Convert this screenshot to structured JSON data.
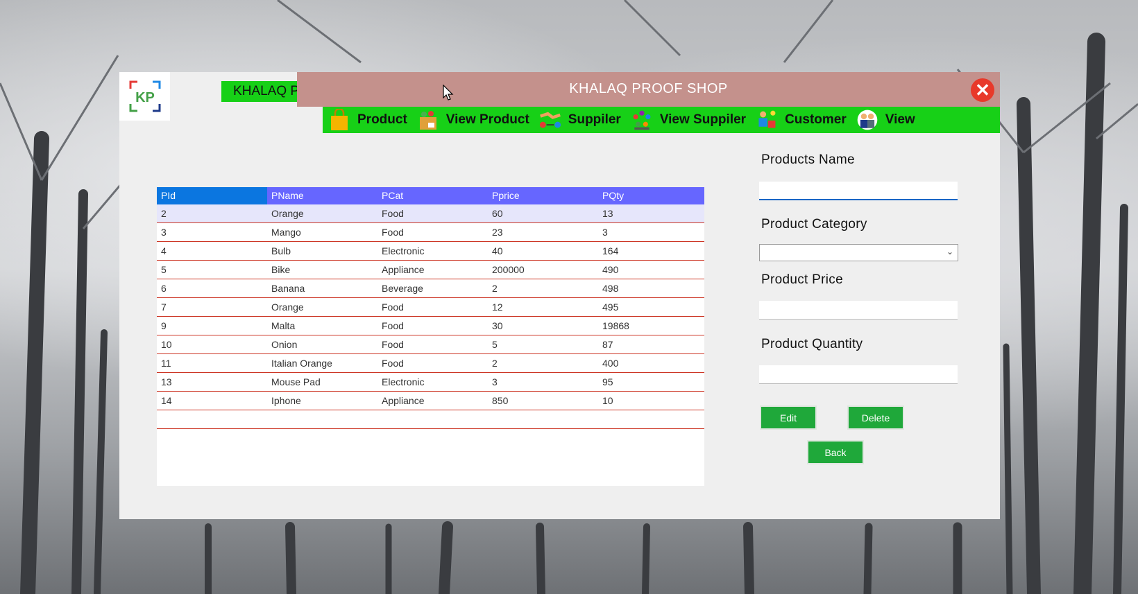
{
  "app": {
    "brand_label": "KHALAQ PROOF",
    "window_title": "KHALAQ PROOF SHOP",
    "logo_text": "KP"
  },
  "nav": {
    "items": [
      {
        "label": "Product",
        "icon": "shopping-bag-icon"
      },
      {
        "label": "View Product",
        "icon": "product-box-icon"
      },
      {
        "label": "Suppiler",
        "icon": "handshake-icon"
      },
      {
        "label": "View Suppiler",
        "icon": "group-icon"
      },
      {
        "label": "Customer",
        "icon": "customer-icon"
      },
      {
        "label": "View",
        "icon": "people-icon"
      }
    ]
  },
  "table": {
    "headers": [
      "PId",
      "PName",
      "PCat",
      "Pprice",
      "PQty"
    ],
    "rows": [
      [
        "2",
        "Orange",
        "Food",
        "60",
        "13"
      ],
      [
        "3",
        "Mango",
        "Food",
        "23",
        "3"
      ],
      [
        "4",
        "Bulb",
        "Electronic",
        "40",
        "164"
      ],
      [
        "5",
        "Bike",
        "Appliance",
        "200000",
        "490"
      ],
      [
        "6",
        "Banana",
        "Beverage",
        "2",
        "498"
      ],
      [
        "7",
        "Orange",
        "Food",
        "12",
        "495"
      ],
      [
        "9",
        "Malta",
        "Food",
        "30",
        "19868"
      ],
      [
        "10",
        "Onion",
        "Food",
        "5",
        "87"
      ],
      [
        "11",
        "Italian Orange",
        "Food",
        "2",
        "400"
      ],
      [
        "13",
        "Mouse Pad",
        "Electronic",
        "3",
        "95"
      ],
      [
        "14",
        "Iphone",
        "Appliance",
        "850",
        "10"
      ],
      [
        "",
        "",
        "",
        "",
        ""
      ]
    ]
  },
  "form": {
    "name_label": "Products Name",
    "name_value": "",
    "category_label": "Product Category",
    "category_value": "",
    "price_label": "Product Price",
    "price_value": "",
    "quantity_label": "Product Quantity",
    "quantity_value": "",
    "edit_label": "Edit",
    "delete_label": "Delete",
    "back_label": "Back"
  },
  "colors": {
    "nav_green": "#17d017",
    "titlebar": "#c4918c",
    "header_blue": "#6666ff",
    "button_green": "#1fa83a",
    "close_red": "#e8392a"
  }
}
